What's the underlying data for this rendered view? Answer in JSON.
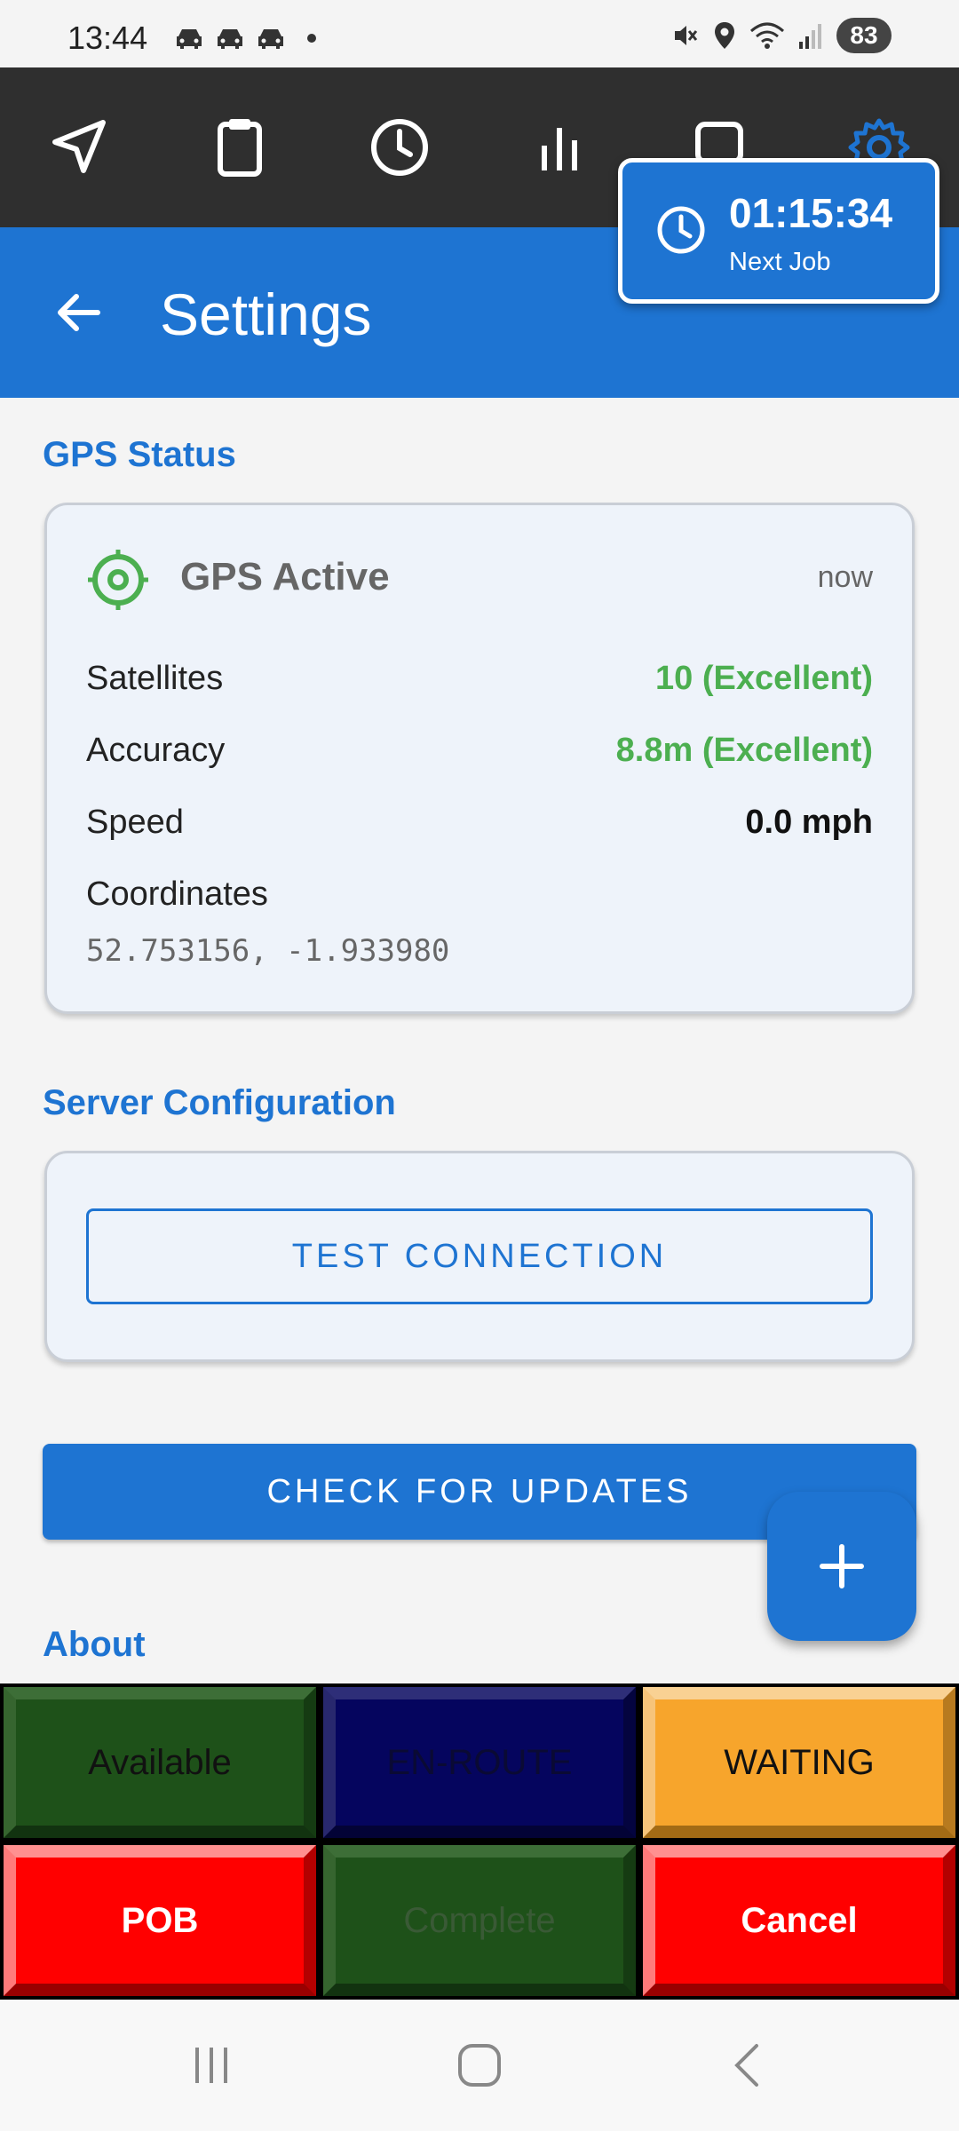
{
  "status_bar": {
    "time": "13:44",
    "battery": "83",
    "notification_icons": [
      "car-icon",
      "car-icon",
      "car-icon",
      "dot-icon"
    ],
    "system_icons": [
      "mute-icon",
      "location-icon",
      "wifi-icon",
      "signal-icon"
    ]
  },
  "tabs": [
    {
      "name": "navigate",
      "icon": "navigation-arrow-icon",
      "active": false
    },
    {
      "name": "jobs",
      "icon": "clipboard-icon",
      "active": false
    },
    {
      "name": "history",
      "icon": "clock-icon",
      "active": false
    },
    {
      "name": "stats",
      "icon": "bar-chart-icon",
      "active": false
    },
    {
      "name": "messages",
      "icon": "chat-icon",
      "active": false
    },
    {
      "name": "settings",
      "icon": "gear-icon",
      "active": true
    }
  ],
  "header": {
    "title": "Settings"
  },
  "next_job": {
    "time": "01:15:34",
    "label": "Next Job"
  },
  "gps_section": {
    "title": "GPS Status",
    "status": "GPS Active",
    "updated": "now",
    "rows": [
      {
        "label": "Satellites",
        "value": "10 (Excellent)",
        "color": "#4caf50"
      },
      {
        "label": "Accuracy",
        "value": "8.8m (Excellent)",
        "color": "#4caf50"
      },
      {
        "label": "Speed",
        "value": "0.0 mph",
        "color": "#111111"
      }
    ],
    "coordinates_label": "Coordinates",
    "coordinates": "52.753156, -1.933980"
  },
  "server_section": {
    "title": "Server Configuration",
    "test_button": "TEST CONNECTION"
  },
  "update_button": "CHECK FOR UPDATES",
  "about_title": "About",
  "status_buttons": [
    {
      "label": "Available"
    },
    {
      "label": "EN-ROUTE"
    },
    {
      "label": "WAITING"
    },
    {
      "label": "POB"
    },
    {
      "label": "Complete"
    },
    {
      "label": "Cancel"
    }
  ],
  "colors": {
    "primary": "#1e74d2",
    "tabbar": "#2f2f2f",
    "success": "#4caf50"
  }
}
